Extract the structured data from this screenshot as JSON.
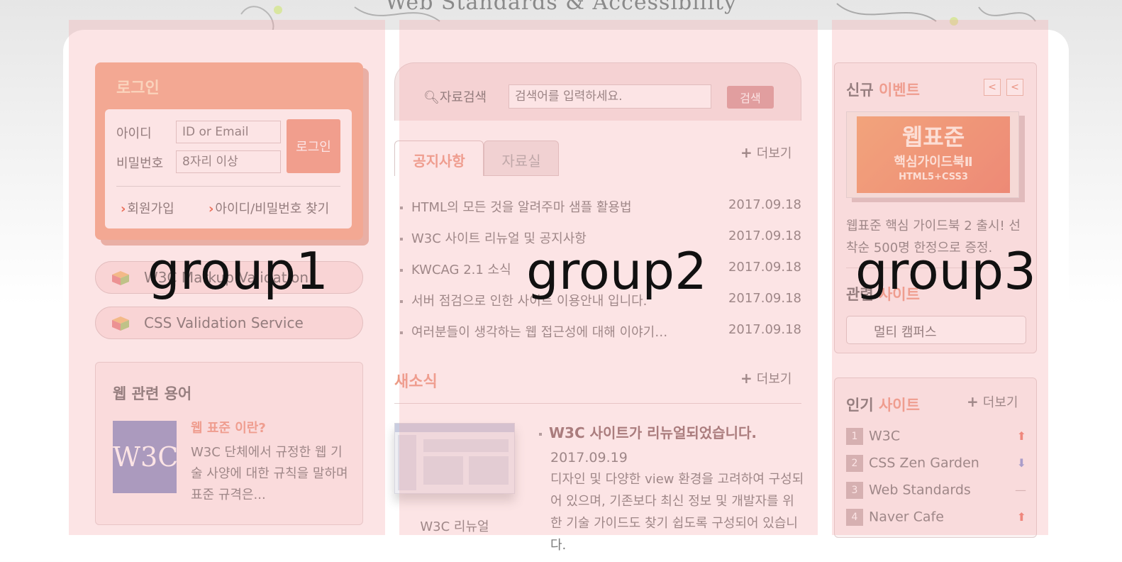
{
  "header": {
    "slogan": "Web Standards & Accessibility"
  },
  "login": {
    "title": "로그인",
    "id_label": "아이디",
    "id_placeholder": "ID or Email",
    "pw_label": "비밀번호",
    "pw_placeholder": "8자리 이상",
    "submit_label": "로그인",
    "signup_label": "회원가입",
    "find_label": "아이디/비밀번호 찾기"
  },
  "validation": {
    "markup_label": "W3C Markup Validation",
    "css_label": "CSS Validation Service"
  },
  "terms": {
    "title": "웹 관련 용어",
    "logo_text": "W3C",
    "subtitle": "웹 표준 이란?",
    "description": "W3C 단체에서 규정한 웹 기술 사양에 대한 규칙을 말하며 표준 규격은..."
  },
  "search": {
    "label": "자료검색",
    "placeholder": "검색어를 입력하세요.",
    "button": "검색"
  },
  "board": {
    "tabs": [
      {
        "label": "공지사항",
        "active": true
      },
      {
        "label": "자료실",
        "active": false
      }
    ],
    "more_label": "더보기",
    "items": [
      {
        "title": "HTML의 모든 것을 알려주마 샘플 활용법",
        "date": "2017.09.18"
      },
      {
        "title": "W3C 사이트 리뉴얼 및 공지사항",
        "date": "2017.09.18"
      },
      {
        "title": "KWCAG 2.1 소식",
        "date": "2017.09.18"
      },
      {
        "title": "서버 점검으로 인한 사이트 이용안내 입니다.",
        "date": "2017.09.18"
      },
      {
        "title": "여러분들이 생각하는 웹 접근성에 대해 이야기…",
        "date": "2017.09.18"
      }
    ]
  },
  "news": {
    "title": "새소식",
    "more_label": "더보기",
    "thumb_caption": "W3C 리뉴얼",
    "headline": "W3C 사이트가 리뉴얼되었습니다.",
    "date": "2017.09.19",
    "description": "디자인 및 다양한 view 환경을 고려하여 구성되어 있으며, 기존보다 최신 정보 및 개발자를 위한 기술 가이드도 찾기 쉽도록 구성되어 있습니다."
  },
  "event": {
    "title_plain": "신규",
    "title_accent": "이벤트",
    "book_line1": "웹표준",
    "book_line2": "핵심가이드북Ⅱ",
    "book_line3": "HTML5+CSS3",
    "text": "웹표준 핵심 가이드북 2 출시! 선착순 500명 한정으로 증정.",
    "related_plain": "관련",
    "related_accent": "사이트",
    "campus_label": "멀티 캠퍼스"
  },
  "popular": {
    "title_plain": "인기",
    "title_accent": "사이트",
    "more_label": "더보기",
    "items": [
      {
        "rank": "1",
        "name": "W3C",
        "trend": "up"
      },
      {
        "rank": "2",
        "name": "CSS Zen Garden",
        "trend": "down"
      },
      {
        "rank": "3",
        "name": "Web Standards",
        "trend": "same"
      },
      {
        "rank": "4",
        "name": "Naver Cafe",
        "trend": "up"
      }
    ]
  },
  "overlay_labels": [
    "group1",
    "group2",
    "group3"
  ],
  "colors": {
    "accent": "#ec9a84",
    "login_bg": "#f3a98a",
    "overlay": "#f4a7aa",
    "trend_up": "#ec7a6a",
    "trend_down": "#8a9ad8"
  }
}
